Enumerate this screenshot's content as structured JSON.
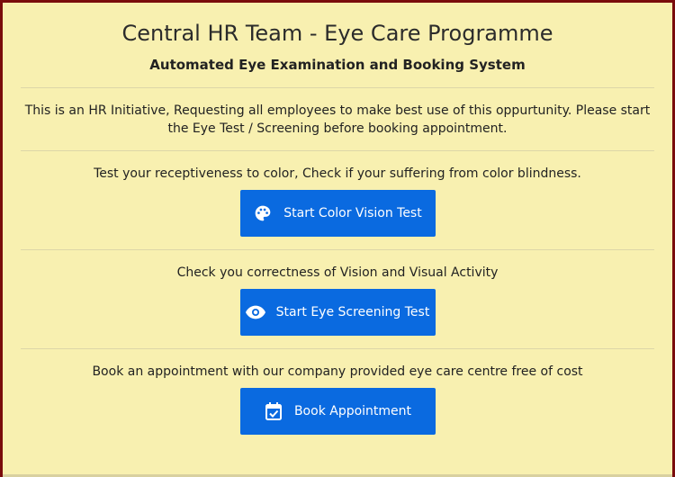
{
  "header": {
    "title": "Central HR Team - Eye Care Programme",
    "subtitle": "Automated Eye Examination and Booking System"
  },
  "intro": {
    "text": "This is an HR Initiative, Requesting all employees to make best use of this oppurtunity. Please start the Eye Test / Screening before booking appointment."
  },
  "sections": [
    {
      "text": "Test your receptiveness to color, Check if your suffering from color blindness.",
      "button_label": "Start Color Vision Test",
      "icon": "palette-icon"
    },
    {
      "text": "Check you correctness of Vision and Visual Activity",
      "button_label": "Start Eye Screening Test",
      "icon": "eye-icon"
    },
    {
      "text": "Book an appointment with our company provided eye care centre free of cost",
      "button_label": "Book Appointment",
      "icon": "calendar-check-icon"
    }
  ],
  "colors": {
    "background": "#f8f0b0",
    "button": "#0a6ae0",
    "border": "#7a0c0c"
  }
}
